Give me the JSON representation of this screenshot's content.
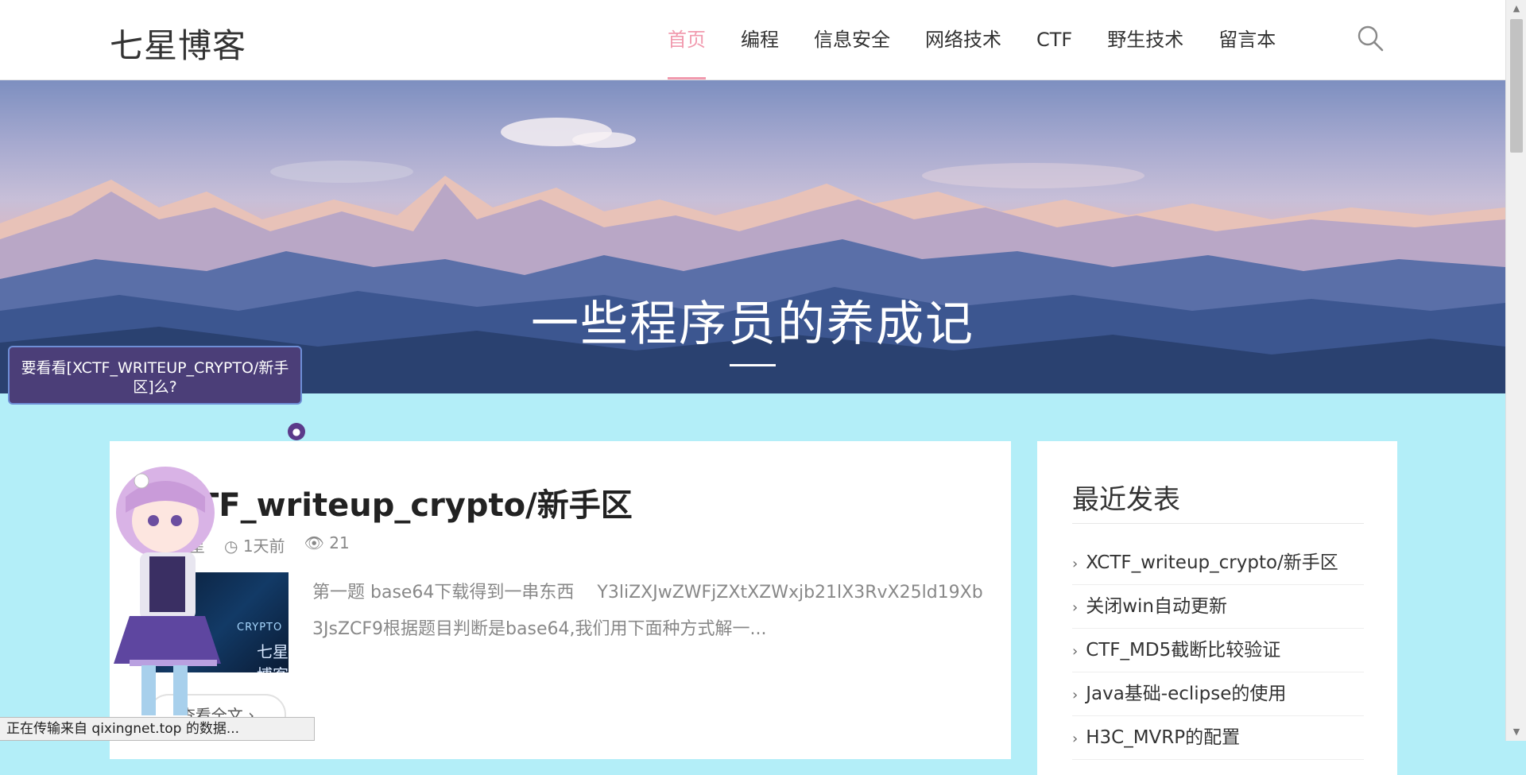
{
  "header": {
    "logo": "七星博客",
    "nav": [
      {
        "label": "首页",
        "active": true
      },
      {
        "label": "编程",
        "active": false
      },
      {
        "label": "信息安全",
        "active": false
      },
      {
        "label": "网络技术",
        "active": false
      },
      {
        "label": "CTF",
        "active": false
      },
      {
        "label": "野生技术",
        "active": false
      },
      {
        "label": "留言本",
        "active": false
      }
    ],
    "search_icon": "search-icon",
    "accent_color": "#f19aae"
  },
  "banner": {
    "title": "一些程序员的养成记"
  },
  "live2d": {
    "tip": "要看看[XCTF_WRITEUP_CRYPTO/新手区]么?",
    "icons": [
      "chat-icon",
      "power-icon"
    ]
  },
  "post": {
    "title": "TF_writeup_crypto/新手区",
    "author": "星",
    "time": "1天前",
    "views": "21",
    "thumb_text": "CRYPTO",
    "thumb_mark": "七星博客",
    "excerpt": "第一题 base64下载得到一串东西　 Y3liZXJwZWFjZXtXZWxjb21lX3RvX25ld19Xb3JsZCF9根据题目判断是base64,我们用下面种方式解一...",
    "read_more": "查看全文"
  },
  "sidebar": {
    "title": "最近发表",
    "items": [
      "XCTF_writeup_crypto/新手区",
      "关闭win自动更新",
      "CTF_MD5截断比较验证",
      "Java基础-eclipse的使用",
      "H3C_MVRP的配置"
    ]
  },
  "status": {
    "text": "正在传输来自 qixingnet.top 的数据..."
  }
}
